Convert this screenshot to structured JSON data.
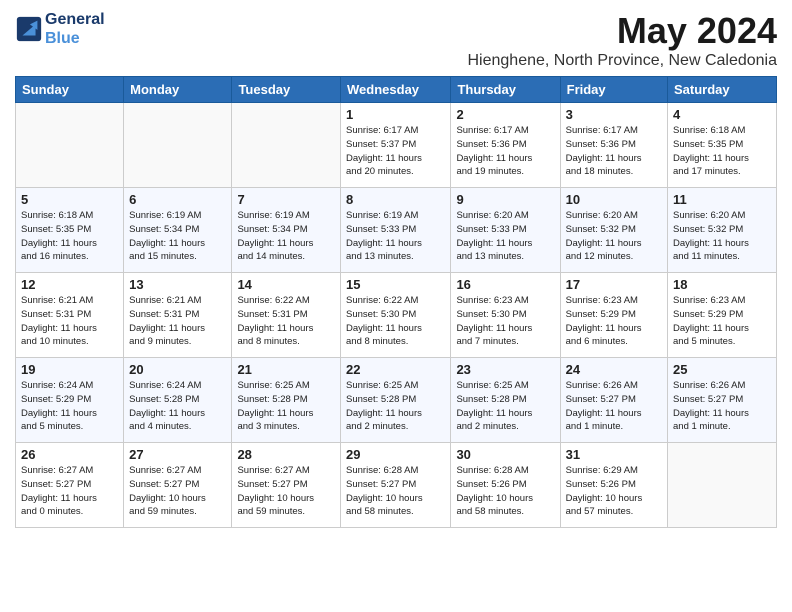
{
  "header": {
    "logo_line1": "General",
    "logo_line2": "Blue",
    "month": "May 2024",
    "location": "Hienghene, North Province, New Caledonia"
  },
  "days_of_week": [
    "Sunday",
    "Monday",
    "Tuesday",
    "Wednesday",
    "Thursday",
    "Friday",
    "Saturday"
  ],
  "weeks": [
    [
      {
        "day": "",
        "info": ""
      },
      {
        "day": "",
        "info": ""
      },
      {
        "day": "",
        "info": ""
      },
      {
        "day": "1",
        "info": "Sunrise: 6:17 AM\nSunset: 5:37 PM\nDaylight: 11 hours\nand 20 minutes."
      },
      {
        "day": "2",
        "info": "Sunrise: 6:17 AM\nSunset: 5:36 PM\nDaylight: 11 hours\nand 19 minutes."
      },
      {
        "day": "3",
        "info": "Sunrise: 6:17 AM\nSunset: 5:36 PM\nDaylight: 11 hours\nand 18 minutes."
      },
      {
        "day": "4",
        "info": "Sunrise: 6:18 AM\nSunset: 5:35 PM\nDaylight: 11 hours\nand 17 minutes."
      }
    ],
    [
      {
        "day": "5",
        "info": "Sunrise: 6:18 AM\nSunset: 5:35 PM\nDaylight: 11 hours\nand 16 minutes."
      },
      {
        "day": "6",
        "info": "Sunrise: 6:19 AM\nSunset: 5:34 PM\nDaylight: 11 hours\nand 15 minutes."
      },
      {
        "day": "7",
        "info": "Sunrise: 6:19 AM\nSunset: 5:34 PM\nDaylight: 11 hours\nand 14 minutes."
      },
      {
        "day": "8",
        "info": "Sunrise: 6:19 AM\nSunset: 5:33 PM\nDaylight: 11 hours\nand 13 minutes."
      },
      {
        "day": "9",
        "info": "Sunrise: 6:20 AM\nSunset: 5:33 PM\nDaylight: 11 hours\nand 13 minutes."
      },
      {
        "day": "10",
        "info": "Sunrise: 6:20 AM\nSunset: 5:32 PM\nDaylight: 11 hours\nand 12 minutes."
      },
      {
        "day": "11",
        "info": "Sunrise: 6:20 AM\nSunset: 5:32 PM\nDaylight: 11 hours\nand 11 minutes."
      }
    ],
    [
      {
        "day": "12",
        "info": "Sunrise: 6:21 AM\nSunset: 5:31 PM\nDaylight: 11 hours\nand 10 minutes."
      },
      {
        "day": "13",
        "info": "Sunrise: 6:21 AM\nSunset: 5:31 PM\nDaylight: 11 hours\nand 9 minutes."
      },
      {
        "day": "14",
        "info": "Sunrise: 6:22 AM\nSunset: 5:31 PM\nDaylight: 11 hours\nand 8 minutes."
      },
      {
        "day": "15",
        "info": "Sunrise: 6:22 AM\nSunset: 5:30 PM\nDaylight: 11 hours\nand 8 minutes."
      },
      {
        "day": "16",
        "info": "Sunrise: 6:23 AM\nSunset: 5:30 PM\nDaylight: 11 hours\nand 7 minutes."
      },
      {
        "day": "17",
        "info": "Sunrise: 6:23 AM\nSunset: 5:29 PM\nDaylight: 11 hours\nand 6 minutes."
      },
      {
        "day": "18",
        "info": "Sunrise: 6:23 AM\nSunset: 5:29 PM\nDaylight: 11 hours\nand 5 minutes."
      }
    ],
    [
      {
        "day": "19",
        "info": "Sunrise: 6:24 AM\nSunset: 5:29 PM\nDaylight: 11 hours\nand 5 minutes."
      },
      {
        "day": "20",
        "info": "Sunrise: 6:24 AM\nSunset: 5:28 PM\nDaylight: 11 hours\nand 4 minutes."
      },
      {
        "day": "21",
        "info": "Sunrise: 6:25 AM\nSunset: 5:28 PM\nDaylight: 11 hours\nand 3 minutes."
      },
      {
        "day": "22",
        "info": "Sunrise: 6:25 AM\nSunset: 5:28 PM\nDaylight: 11 hours\nand 2 minutes."
      },
      {
        "day": "23",
        "info": "Sunrise: 6:25 AM\nSunset: 5:28 PM\nDaylight: 11 hours\nand 2 minutes."
      },
      {
        "day": "24",
        "info": "Sunrise: 6:26 AM\nSunset: 5:27 PM\nDaylight: 11 hours\nand 1 minute."
      },
      {
        "day": "25",
        "info": "Sunrise: 6:26 AM\nSunset: 5:27 PM\nDaylight: 11 hours\nand 1 minute."
      }
    ],
    [
      {
        "day": "26",
        "info": "Sunrise: 6:27 AM\nSunset: 5:27 PM\nDaylight: 11 hours\nand 0 minutes."
      },
      {
        "day": "27",
        "info": "Sunrise: 6:27 AM\nSunset: 5:27 PM\nDaylight: 10 hours\nand 59 minutes."
      },
      {
        "day": "28",
        "info": "Sunrise: 6:27 AM\nSunset: 5:27 PM\nDaylight: 10 hours\nand 59 minutes."
      },
      {
        "day": "29",
        "info": "Sunrise: 6:28 AM\nSunset: 5:27 PM\nDaylight: 10 hours\nand 58 minutes."
      },
      {
        "day": "30",
        "info": "Sunrise: 6:28 AM\nSunset: 5:26 PM\nDaylight: 10 hours\nand 58 minutes."
      },
      {
        "day": "31",
        "info": "Sunrise: 6:29 AM\nSunset: 5:26 PM\nDaylight: 10 hours\nand 57 minutes."
      },
      {
        "day": "",
        "info": ""
      }
    ]
  ]
}
